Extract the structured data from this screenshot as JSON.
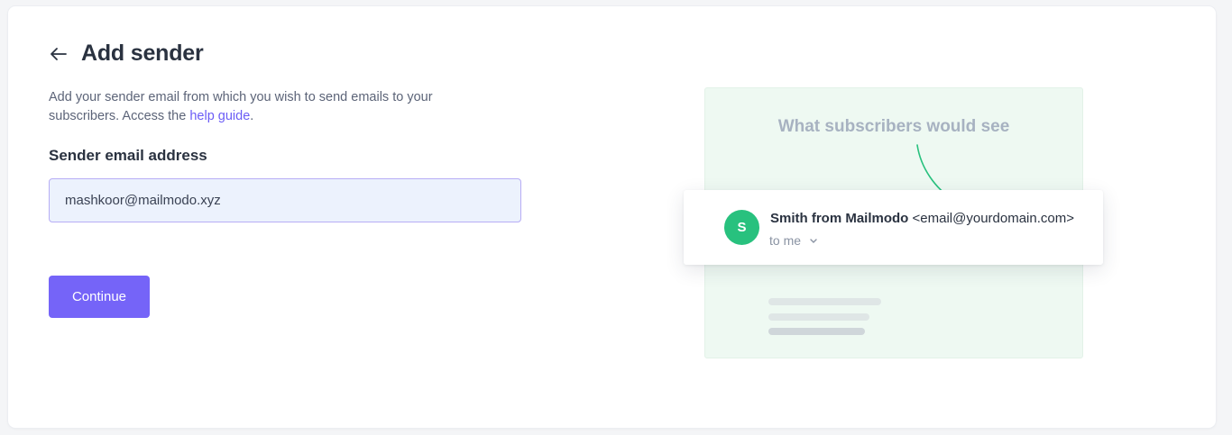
{
  "header": {
    "back_icon": "arrow-left-icon",
    "title": "Add sender"
  },
  "description": {
    "text_before": "Add your sender email from which you wish to send emails to your subscribers. Access the ",
    "link_text": "help guide",
    "text_after": "."
  },
  "form": {
    "label": "Sender email address",
    "email_value": "mashkoor@mailmodo.xyz",
    "continue_label": "Continue"
  },
  "preview": {
    "caption": "What subscribers would see",
    "avatar_letter": "S",
    "sender_name": "Smith from Mailmodo",
    "sender_email": "<email@yourdomain.com>",
    "to_text": "to me",
    "chevron_icon": "chevron-down-icon",
    "arrow_icon": "curved-arrow-icon"
  },
  "colors": {
    "accent": "#7564f8",
    "link": "#6b5cf6",
    "avatar": "#28c17e",
    "preview_bg": "#eef9f2"
  }
}
